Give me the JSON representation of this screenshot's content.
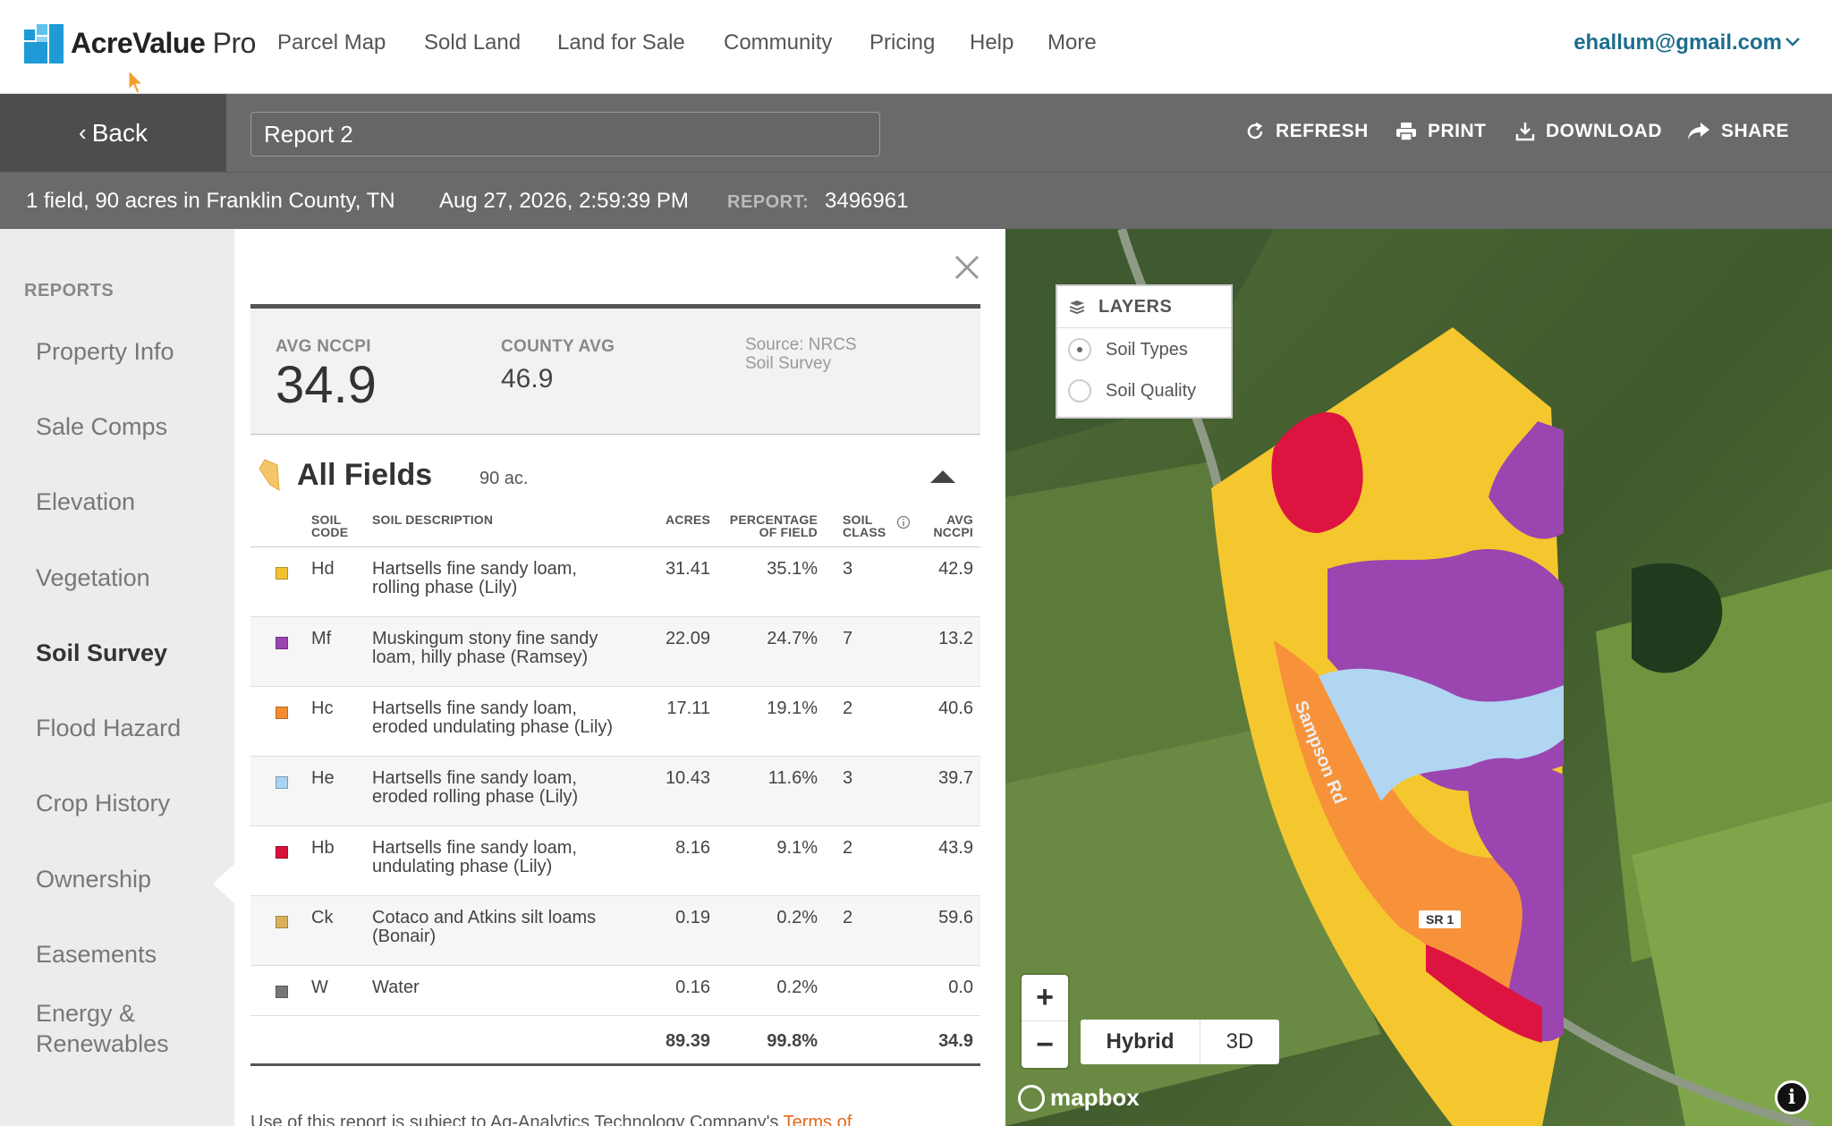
{
  "app": {
    "logo_name": "AcreValue",
    "logo_suffix": "Pro",
    "nav": [
      "Parcel Map",
      "Sold Land",
      "Land for Sale",
      "Community",
      "Pricing",
      "Help",
      "More"
    ],
    "user_email": "ehallum@gmail.com"
  },
  "toolbar": {
    "back_label": "Back",
    "report_name": "Report 2",
    "refresh_label": "REFRESH",
    "print_label": "PRINT",
    "download_label": "DOWNLOAD",
    "share_label": "SHARE"
  },
  "info": {
    "summary": "1 field, 90 acres in Franklin County, TN",
    "date": "Aug 27, 2026, 2:59:39 PM",
    "report_label": "REPORT:",
    "report_number": "3496961"
  },
  "sidebar": {
    "heading": "REPORTS",
    "items": [
      "Property Info",
      "Sale Comps",
      "Elevation",
      "Vegetation",
      "Soil Survey",
      "Flood Hazard",
      "Crop History",
      "Ownership",
      "Easements",
      "Energy & Renewables"
    ],
    "active": "Soil Survey"
  },
  "summary": {
    "avg_nccpi_label": "AVG NCCPI",
    "avg_nccpi_value": "34.9",
    "county_avg_label": "COUNTY AVG",
    "county_avg_value": "46.9",
    "source": "Source: NRCS Soil Survey"
  },
  "fields": {
    "title": "All Fields",
    "acres": "90 ac."
  },
  "table": {
    "headers": {
      "soil_code": "SOIL CODE",
      "soil_description": "SOIL DESCRIPTION",
      "acres": "ACRES",
      "percentage": "PERCENTAGE OF FIELD",
      "soil_class": "SOIL CLASS",
      "avg_nccpi": "AVG NCCPI"
    },
    "rows": [
      {
        "color": "#f2c12e",
        "code": "Hd",
        "desc1": "Hartsells fine sandy loam,",
        "desc2": "rolling phase (Lily)",
        "acres": "31.41",
        "pct": "35.1%",
        "cls": "3",
        "nccpi": "42.9"
      },
      {
        "color": "#9b45b0",
        "code": "Mf",
        "desc1": "Muskingum stony fine sandy",
        "desc2": "loam, hilly phase (Ramsey)",
        "acres": "22.09",
        "pct": "24.7%",
        "cls": "7",
        "nccpi": "13.2"
      },
      {
        "color": "#f28c30",
        "code": "Hc",
        "desc1": "Hartsells fine sandy loam,",
        "desc2": "eroded undulating phase (Lily)",
        "acres": "17.11",
        "pct": "19.1%",
        "cls": "2",
        "nccpi": "40.6"
      },
      {
        "color": "#a9d3f2",
        "code": "He",
        "desc1": "Hartsells fine sandy loam,",
        "desc2": "eroded rolling phase (Lily)",
        "acres": "10.43",
        "pct": "11.6%",
        "cls": "3",
        "nccpi": "39.7"
      },
      {
        "color": "#d6123a",
        "code": "Hb",
        "desc1": "Hartsells fine sandy loam,",
        "desc2": "undulating phase (Lily)",
        "acres": "8.16",
        "pct": "9.1%",
        "cls": "2",
        "nccpi": "43.9"
      },
      {
        "color": "#d9b15a",
        "code": "Ck",
        "desc1": "Cotaco and Atkins silt loams",
        "desc2": "(Bonair)",
        "acres": "0.19",
        "pct": "0.2%",
        "cls": "2",
        "nccpi": "59.6"
      },
      {
        "color": "#777777",
        "code": "W",
        "desc1": "Water",
        "desc2": "",
        "acres": "0.16",
        "pct": "0.2%",
        "cls": "",
        "nccpi": "0.0"
      }
    ],
    "totals": {
      "acres": "89.39",
      "pct": "99.8%",
      "nccpi": "34.9"
    }
  },
  "footer": {
    "text": "Use of this report is subject to Ag-Analytics Technology Company's ",
    "link": "Terms of"
  },
  "map": {
    "layers_title": "LAYERS",
    "layer_options": [
      "Soil Types",
      "Soil Quality"
    ],
    "selected_layer": "Soil Types",
    "view_hybrid": "Hybrid",
    "view_3d": "3D",
    "attribution": "mapbox",
    "road_label": "Sampson Rd",
    "route_shield": "SR 1",
    "soil_colors": {
      "Hd": "#f5c72e",
      "Mf": "#9b45b0",
      "Hc": "#f7923a",
      "He": "#b0d6f2",
      "Hb": "#dd1440"
    }
  }
}
